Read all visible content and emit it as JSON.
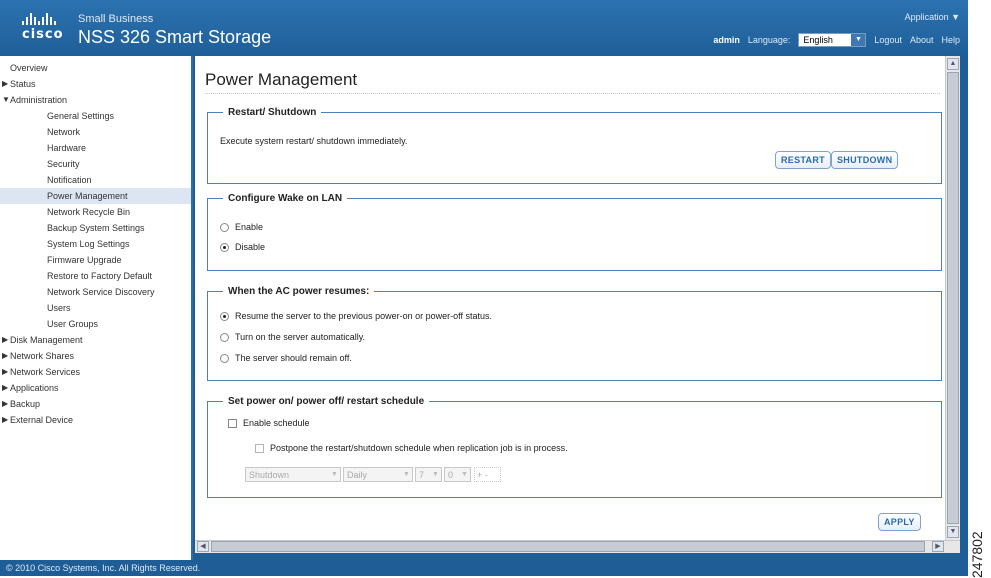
{
  "header": {
    "small_business": "Small Business",
    "brand_word": "cisco",
    "product": "NSS 326 Smart Storage",
    "application_menu": "Application ▼",
    "user": "admin",
    "language_label": "Language:",
    "language_value": "English",
    "logout": "Logout",
    "about": "About",
    "help": "Help"
  },
  "sidebar": {
    "overview": "Overview",
    "status": "Status",
    "administration": "Administration",
    "admin_items": [
      "General Settings",
      "Network",
      "Hardware",
      "Security",
      "Notification",
      "Power Management",
      "Network Recycle Bin",
      "Backup System Settings",
      "System Log Settings",
      "Firmware Upgrade",
      "Restore to Factory Default",
      "Network Service Discovery",
      "Users",
      "User Groups"
    ],
    "active_item": "Power Management",
    "bottom_items": [
      "Disk Management",
      "Network Shares",
      "Network Services",
      "Applications",
      "Backup",
      "External Device"
    ]
  },
  "page": {
    "title": "Power Management",
    "restart": {
      "legend": "Restart/ Shutdown",
      "description": "Execute system restart/ shutdown immediately.",
      "restart_button": "RESTART",
      "shutdown_button": "SHUTDOWN"
    },
    "wol": {
      "legend": "Configure Wake on LAN",
      "enable": "Enable",
      "disable": "Disable",
      "selected": "Disable"
    },
    "ac": {
      "legend": "When the AC power resumes:",
      "option1": "Resume the server to the previous power-on or power-off status.",
      "option2": "Turn on the server automatically.",
      "option3": "The server should remain off.",
      "selected": "option1"
    },
    "schedule": {
      "legend": "Set power on/ power off/ restart schedule",
      "enable_label": "Enable schedule",
      "enable_checked": false,
      "postpone_label": "Postpone the restart/shutdown schedule when replication job is in process.",
      "postpone_checked": false,
      "action": "Shutdown",
      "frequency": "Daily",
      "hour": "7",
      "minute": "0",
      "add_symbol": "+ -"
    },
    "apply_button": "APPLY"
  },
  "footer": {
    "copyright": "© 2010 Cisco Systems, Inc. All Rights Reserved."
  },
  "figure_number": "247802"
}
